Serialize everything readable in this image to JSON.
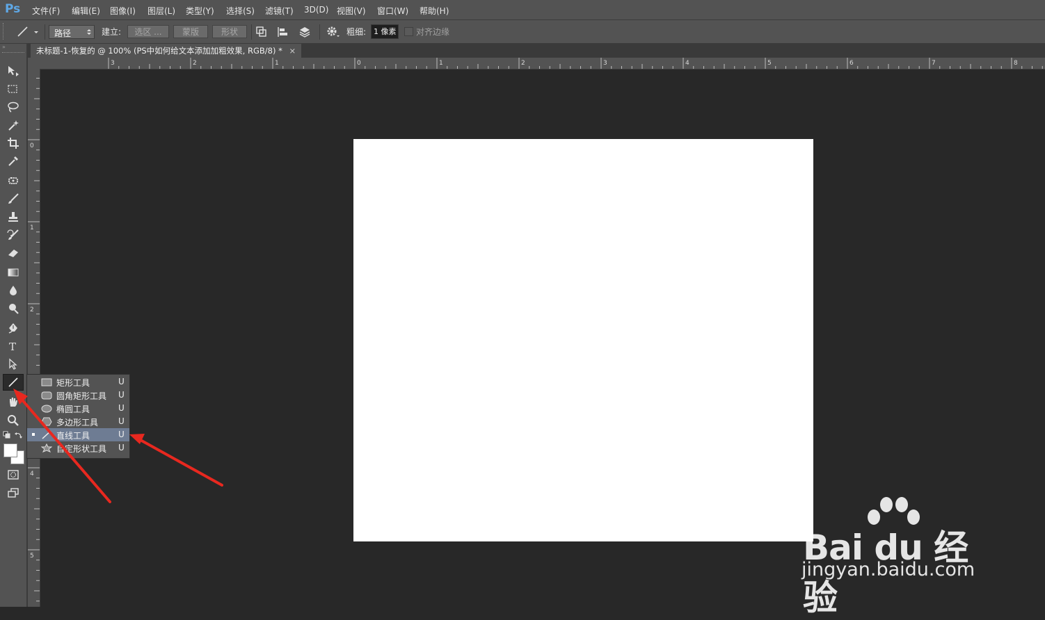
{
  "app": {
    "logo": "Ps"
  },
  "menu": [
    "文件(F)",
    "编辑(E)",
    "图像(I)",
    "图层(L)",
    "类型(Y)",
    "选择(S)",
    "滤镜(T)",
    "3D(D)",
    "视图(V)",
    "窗口(W)",
    "帮助(H)"
  ],
  "options": {
    "mode": "路径",
    "make_label": "建立:",
    "selection_btn": "选区 ...",
    "mask_btn": "蒙版",
    "shape_btn": "形状",
    "weight_label": "粗细:",
    "weight_value": "1 像素",
    "align_edges": "对齐边缘"
  },
  "document_tab": {
    "title": "未标题-1-恢复的 @ 100% (PS中如何给文本添加加粗效果, RGB/8) *",
    "close": "×"
  },
  "ruler": {
    "h_labels": [
      "3",
      "2",
      "1",
      "0",
      "1",
      "2",
      "3",
      "4",
      "5",
      "6",
      "7",
      "8"
    ],
    "v_labels": [
      "0",
      "1",
      "2",
      "3",
      "4",
      "5"
    ]
  },
  "tools": [
    "move-tool",
    "marquee-tool",
    "lasso-tool",
    "magic-wand-tool",
    "crop-tool",
    "eyedropper-tool",
    "healing-brush-tool",
    "brush-tool",
    "clone-stamp-tool",
    "history-brush-tool",
    "eraser-tool",
    "gradient-tool",
    "blur-tool",
    "dodge-tool",
    "pen-tool",
    "type-tool",
    "path-selection-tool",
    "line-tool",
    "hand-tool",
    "zoom-tool"
  ],
  "flyout": [
    {
      "label": "矩形工具",
      "key": "U",
      "icon": "rectangle-icon"
    },
    {
      "label": "圆角矩形工具",
      "key": "U",
      "icon": "rounded-rectangle-icon"
    },
    {
      "label": "椭圆工具",
      "key": "U",
      "icon": "ellipse-icon"
    },
    {
      "label": "多边形工具",
      "key": "U",
      "icon": "polygon-icon"
    },
    {
      "label": "直线工具",
      "key": "U",
      "icon": "line-icon",
      "selected": true
    },
    {
      "label": "自定形状工具",
      "key": "U",
      "icon": "custom-shape-icon"
    }
  ],
  "watermark": {
    "brand": "Bai du 经验",
    "url": "jingyan.baidu.com"
  },
  "colors": {
    "annotation_arrow": "#e8281f",
    "flyout_selected": "#6e7c93",
    "ps_blue": "#5fa8e6"
  }
}
